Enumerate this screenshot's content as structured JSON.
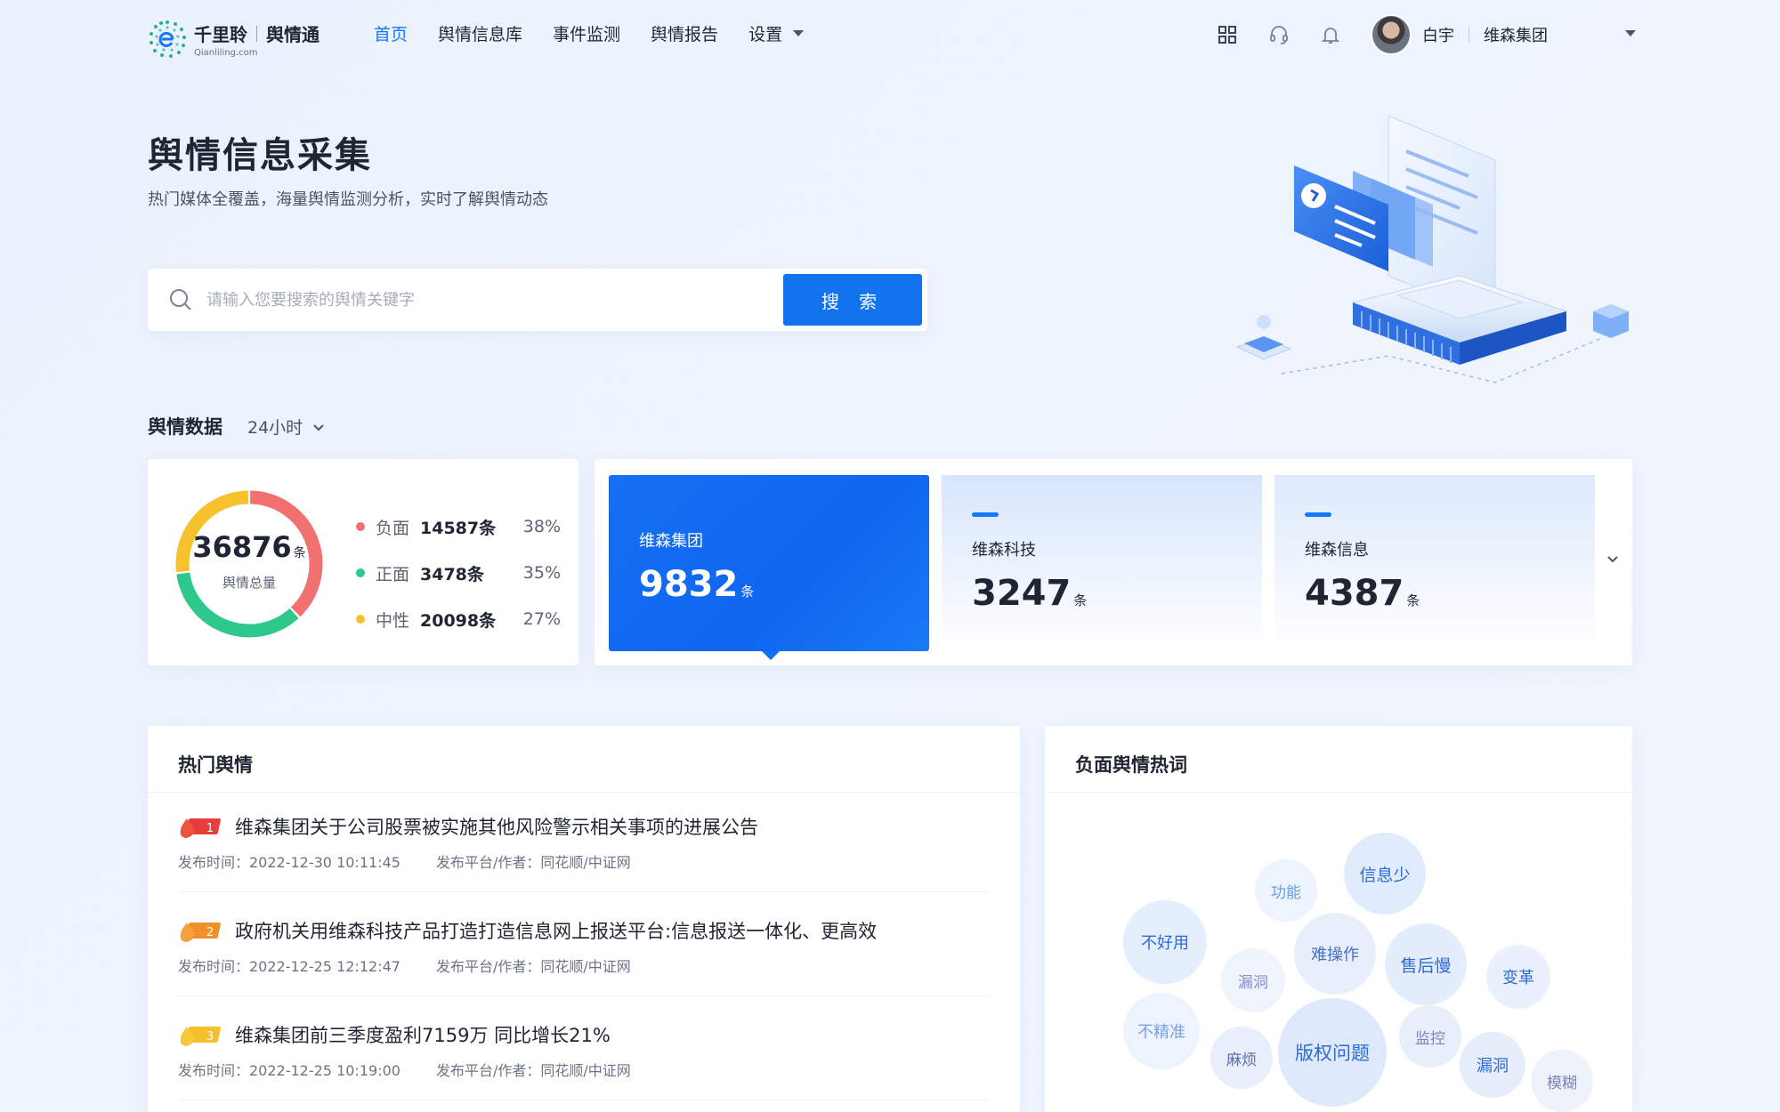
{
  "header": {
    "brand": "千里聆",
    "product": "舆情通",
    "brand_en": "Qianliling.com",
    "nav": [
      {
        "label": "首页",
        "active": true
      },
      {
        "label": "舆情信息库"
      },
      {
        "label": "事件监测"
      },
      {
        "label": "舆情报告"
      },
      {
        "label": "设置"
      }
    ],
    "icons": [
      "apps-grid-icon",
      "headset-icon",
      "bell-icon"
    ],
    "user_name": "白宇",
    "org_name": "维森集团"
  },
  "hero": {
    "title": "舆情信息采集",
    "subtitle": "热门媒体全覆盖，海量舆情监测分析，实时了解舆情动态",
    "search_placeholder": "请输入您要搜索的舆情关键字",
    "search_value": "",
    "search_button": "搜 索"
  },
  "stats": {
    "section_title": "舆情数据",
    "range": "24小时",
    "total": "36876",
    "total_unit": "条",
    "total_label": "舆情总量",
    "breakdown": [
      {
        "name": "负面",
        "count": "14587条",
        "percent": "38%",
        "value": 38,
        "color": "#f27070"
      },
      {
        "name": "正面",
        "count": "3478条",
        "percent": "35%",
        "value": 35,
        "color": "#2ec98a"
      },
      {
        "name": "中性",
        "count": "20098条",
        "percent": "27%",
        "value": 27,
        "color": "#f7c12d"
      }
    ]
  },
  "companies": [
    {
      "name": "维森集团",
      "value": "9832",
      "unit": "条",
      "selected": true
    },
    {
      "name": "维森科技",
      "value": "3247",
      "unit": "条"
    },
    {
      "name": "维森信息",
      "value": "4387",
      "unit": "条"
    }
  ],
  "hot": {
    "title": "热门舆情",
    "items": [
      {
        "rank": "1",
        "title": "维森集团关于公司股票被实施其他风险警示相关事项的进展公告",
        "time": "发布时间：2022-12-30 10:11:45",
        "source": "发布平台/作者：同花顺/中证网"
      },
      {
        "rank": "2",
        "title": "政府机关用维森科技产品打造打造信息网上报送平台:信息报送一体化、更高效",
        "time": "发布时间：2022-12-25 12:12:47",
        "source": "发布平台/作者：同花顺/中证网"
      },
      {
        "rank": "3",
        "title": "维森集团前三季度盈利7159万 同比增长21%",
        "time": "发布时间：2022-12-25 10:19:00",
        "source": "发布平台/作者：同花顺/中证网"
      }
    ]
  },
  "cloud": {
    "title": "负面舆情热词",
    "words": [
      "信息少",
      "功能",
      "不好用",
      "难操作",
      "漏洞",
      "售后慢",
      "变革",
      "不精准",
      "版权问题",
      "麻烦",
      "监控",
      "漏洞",
      "模糊"
    ]
  },
  "colors": {
    "accent": "#1677ff",
    "negative": "#f27070",
    "positive": "#2ec98a",
    "neutral": "#f7c12d"
  }
}
